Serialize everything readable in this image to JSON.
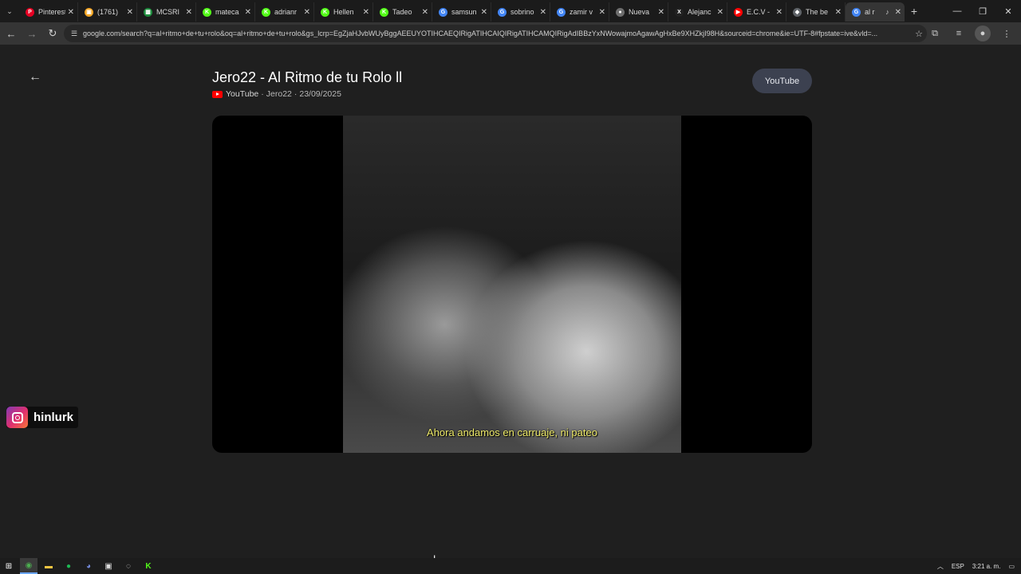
{
  "browser": {
    "tabs": [
      {
        "label": "Pinterest",
        "favicon": "pinterest-icon",
        "color": "#e60023",
        "glyph": "P"
      },
      {
        "label": "(1761)",
        "favicon": "chat-icon",
        "color": "#f5a623",
        "glyph": "▣"
      },
      {
        "label": "MCSRI",
        "favicon": "spreadsheet-icon",
        "color": "#1e8e3e",
        "glyph": "▦"
      },
      {
        "label": "mateca",
        "favicon": "kick-icon",
        "color": "#53fc18",
        "glyph": "K"
      },
      {
        "label": "adrianr",
        "favicon": "kick-icon",
        "color": "#53fc18",
        "glyph": "K"
      },
      {
        "label": "Hellen",
        "favicon": "kick-icon",
        "color": "#53fc18",
        "glyph": "K"
      },
      {
        "label": "Tadeo",
        "favicon": "kick-icon",
        "color": "#53fc18",
        "glyph": "K"
      },
      {
        "label": "samsun",
        "favicon": "google-icon",
        "color": "#4285f4",
        "glyph": "G"
      },
      {
        "label": "sobrino",
        "favicon": "google-icon",
        "color": "#4285f4",
        "glyph": "G"
      },
      {
        "label": "zamir v",
        "favicon": "google-icon",
        "color": "#4285f4",
        "glyph": "G"
      },
      {
        "label": "Nueva",
        "favicon": "github-icon",
        "color": "#6e6e6e",
        "glyph": "●"
      },
      {
        "label": "Alejanc",
        "favicon": "x-icon",
        "color": "#222222",
        "glyph": "X"
      },
      {
        "label": "E.C.V -",
        "favicon": "youtube-icon",
        "color": "#ff0000",
        "glyph": "▶"
      },
      {
        "label": "The be",
        "favicon": "site-icon",
        "color": "#5f6368",
        "glyph": "◆"
      },
      {
        "label": "al r",
        "favicon": "google-icon",
        "color": "#4285f4",
        "glyph": "G",
        "active": true
      }
    ],
    "url": "google.com/search?q=al+ritmo+de+tu+rolo&oq=al+ritmo+de+tu+rolo&gs_lcrp=EgZjaHJvbWUyBggAEEUYOTIHCAEQIRigATIHCAIQIRigATIHCAMQIRigAdIBBzYxNWowajmoAgawAgHxBe9XHZkjI98H&sourceid=chrome&ie=UTF-8#fpstate=ive&vld=..."
  },
  "video": {
    "title": "Jero22 - Al Ritmo de tu Rolo ll",
    "source": "YouTube",
    "channel": "Jero22",
    "date": "23/09/2025",
    "sep1": "·",
    "sep2": "·",
    "youtube_button": "YouTube",
    "subtitle": "Ahora andamos en carruaje, ni pateo"
  },
  "overlay": {
    "instagram_handle": "hinlurk"
  },
  "taskbar": {
    "language": "ESP",
    "time": "3:21 a. m."
  }
}
